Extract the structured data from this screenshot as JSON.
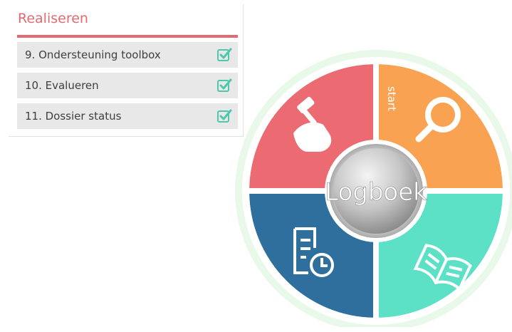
{
  "section": {
    "title": "Realiseren"
  },
  "checklist": {
    "items": [
      {
        "label": "9. Ondersteuning toolbox",
        "checked": true,
        "icon": "checkbox-checked-icon"
      },
      {
        "label": "10. Evalueren",
        "checked": true,
        "icon": "checkbox-checked-icon"
      },
      {
        "label": "11. Dossier status",
        "checked": true,
        "icon": "checkbox-checked-icon"
      }
    ]
  },
  "wheel": {
    "center_label": "Logboek",
    "start_label": "start",
    "segments": [
      {
        "name": "realiseren",
        "color": "#ec6a72",
        "icon": "hand-hammer-icon"
      },
      {
        "name": "onderzoeken",
        "color": "#f9a352",
        "icon": "magnifier-icon"
      },
      {
        "name": "leren",
        "color": "#5ce0c6",
        "icon": "open-book-icon"
      },
      {
        "name": "logboek-tijd",
        "color": "#2e6f9e",
        "icon": "document-clock-icon"
      }
    ],
    "ring_color": "#e8f9ea",
    "check_color": "#4ec8ad"
  }
}
